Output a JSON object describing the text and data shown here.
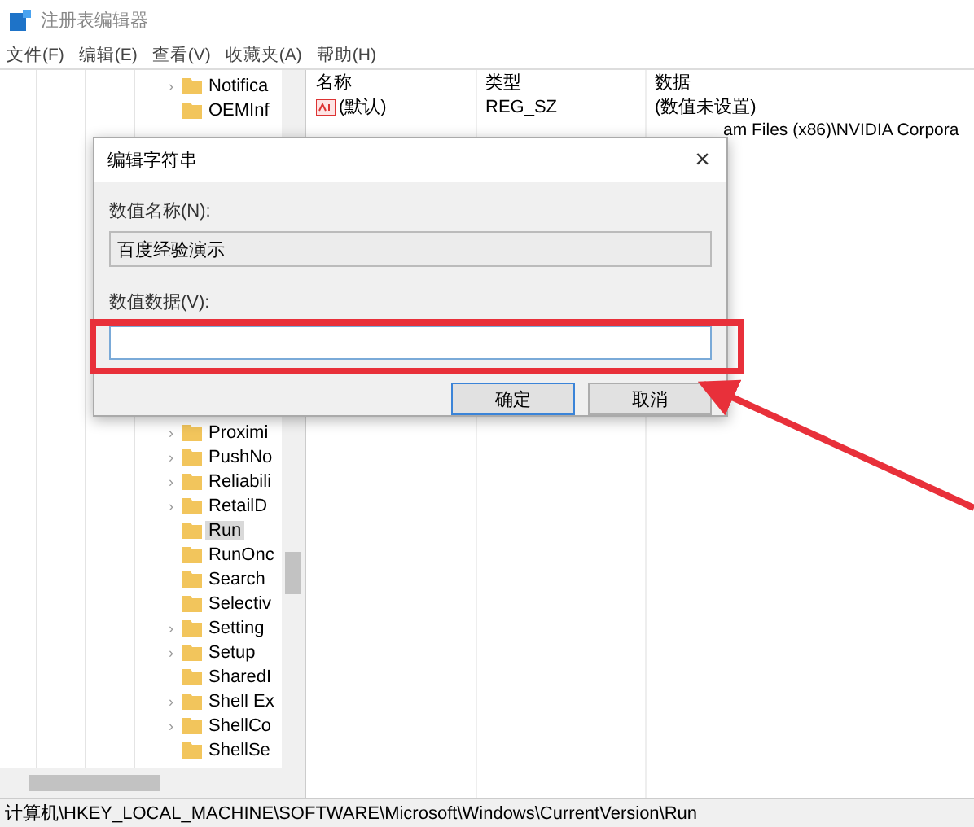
{
  "window": {
    "title": "注册表编辑器"
  },
  "menu": [
    "文件(F)",
    "编辑(E)",
    "查看(V)",
    "收藏夹(A)",
    "帮助(H)"
  ],
  "tree": {
    "items_top": [
      {
        "label": "Notifica",
        "expander": "›",
        "selected": false
      },
      {
        "label": "OEMInf",
        "selected": false
      }
    ],
    "items_bottom": [
      {
        "label": "Proximi",
        "expander": "›",
        "selected": false
      },
      {
        "label": "PushNo",
        "expander": "›",
        "selected": false
      },
      {
        "label": "Reliabili",
        "expander": "›",
        "selected": false
      },
      {
        "label": "RetailD",
        "expander": "›",
        "selected": false
      },
      {
        "label": "Run",
        "selected": true
      },
      {
        "label": "RunOnc",
        "selected": false
      },
      {
        "label": "Search",
        "selected": false
      },
      {
        "label": "Selectiv",
        "selected": false
      },
      {
        "label": "Setting",
        "expander": "›",
        "selected": false
      },
      {
        "label": "Setup",
        "expander": "›",
        "selected": false
      },
      {
        "label": "SharedI",
        "selected": false
      },
      {
        "label": "Shell Ex",
        "expander": "›",
        "selected": false
      },
      {
        "label": "ShellCo",
        "expander": "›",
        "selected": false
      },
      {
        "label": "ShellSe",
        "selected": false
      }
    ]
  },
  "list": {
    "columns": [
      "名称",
      "类型",
      "数据"
    ],
    "rows": [
      {
        "name": "(默认)",
        "type": "REG_SZ",
        "data": "(数值未设置)"
      }
    ],
    "partial_row_data": "am Files (x86)\\NVIDIA Corpora"
  },
  "dialog": {
    "title": "编辑字符串",
    "close": "×",
    "name_label": "数值名称(N):",
    "name_value": "百度经验演示",
    "data_label": "数值数据(V):",
    "buttons": [
      {
        "label": "确定",
        "focused": true
      },
      {
        "label": "取消",
        "focused": false
      }
    ]
  },
  "status_bar": "计算机\\HKEY_LOCAL_MACHINE\\SOFTWARE\\Microsoft\\Windows\\CurrentVersion\\Run"
}
